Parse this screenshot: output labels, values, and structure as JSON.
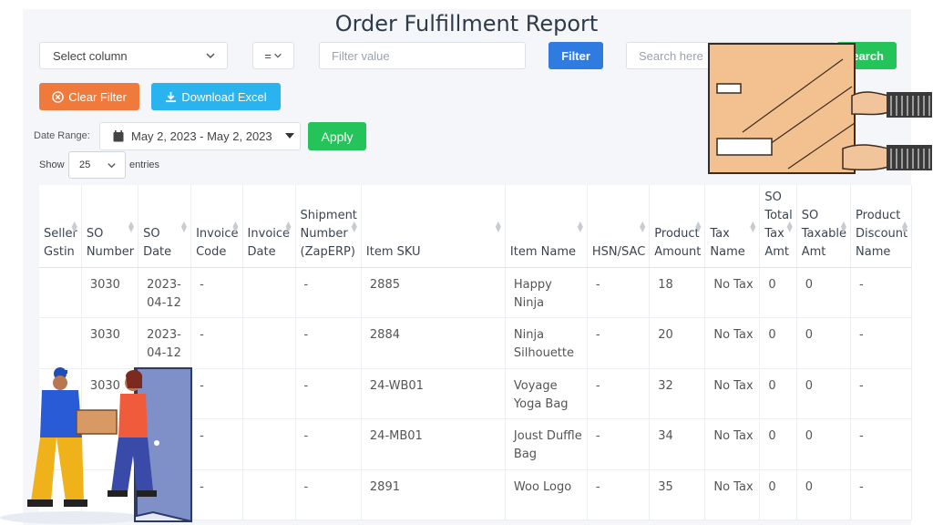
{
  "title": "Order Fulfillment Report",
  "filters": {
    "column_select": "Select column",
    "operator": "=",
    "filter_placeholder": "Filter value",
    "filter_button": "Filter",
    "search_placeholder": "Search here",
    "search_button": "Search",
    "clear_button": "Clear Filter",
    "download_button": "Download Excel"
  },
  "date_range": {
    "label": "Date Range:",
    "value": "May 2, 2023 - May 2, 2023",
    "apply_button": "Apply"
  },
  "length": {
    "show_label": "Show",
    "value": "25",
    "entries_label": "entries"
  },
  "table": {
    "headers": [
      [
        "Seller",
        "Gstin"
      ],
      [
        "SO",
        "Number"
      ],
      [
        "SO",
        "Date"
      ],
      [
        "Invoice",
        "Code"
      ],
      [
        "Invoice",
        "Date"
      ],
      [
        "Shipment",
        "Number",
        "(ZapERP)"
      ],
      [
        "Item SKU"
      ],
      [
        "Item Name"
      ],
      [
        "HSN/SAC"
      ],
      [
        "Product",
        "Amount"
      ],
      [
        "Tax",
        "Name"
      ],
      [
        "SO",
        "Total",
        "Tax",
        "Amt"
      ],
      [
        "SO",
        "Taxable",
        "Amt"
      ],
      [
        "Product",
        "Discount",
        "Name"
      ]
    ],
    "rows": [
      [
        "",
        "3030",
        "2023-04-12",
        "-",
        "",
        "-",
        "2885",
        "Happy Ninja",
        "-",
        "18",
        "No Tax",
        "0",
        "0",
        "-"
      ],
      [
        "",
        "3030",
        "2023-04-12",
        "-",
        "",
        "-",
        "2884",
        "Ninja Silhouette",
        "-",
        "20",
        "No Tax",
        "0",
        "0",
        "-"
      ],
      [
        "",
        "3030",
        "",
        "-",
        "",
        "-",
        "24-WB01",
        "Voyage Yoga Bag",
        "-",
        "32",
        "No Tax",
        "0",
        "0",
        "-"
      ],
      [
        "",
        "",
        "",
        "-",
        "",
        "-",
        "24-MB01",
        "Joust Duffle Bag",
        "-",
        "34",
        "No Tax",
        "0",
        "0",
        "-"
      ],
      [
        "",
        "",
        "",
        "-",
        "",
        "-",
        "2891",
        "Woo Logo",
        "-",
        "35",
        "No Tax",
        "0",
        "0",
        "-"
      ]
    ]
  }
}
